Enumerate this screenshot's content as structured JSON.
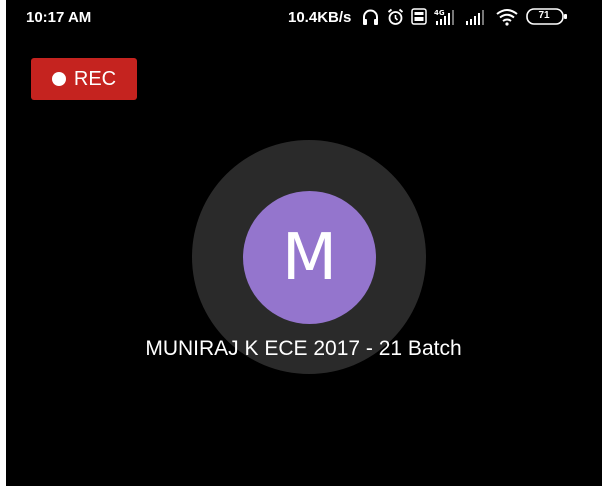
{
  "status_bar": {
    "time": "10:17 AM",
    "net_speed": "10.4KB/s",
    "network_type": "4G",
    "battery_level": "71",
    "icons": [
      "headphones-icon",
      "alarm-icon",
      "volte-icon",
      "signal-icon",
      "signal-icon",
      "wifi-icon",
      "battery-icon"
    ]
  },
  "recording": {
    "label": "REC",
    "color": "#c5231f"
  },
  "participant": {
    "initial": "M",
    "name": "MUNIRAJ K ECE 2017 - 21 Batch",
    "avatar_color": "#9475cd",
    "ring_color": "#2a2a2a"
  }
}
